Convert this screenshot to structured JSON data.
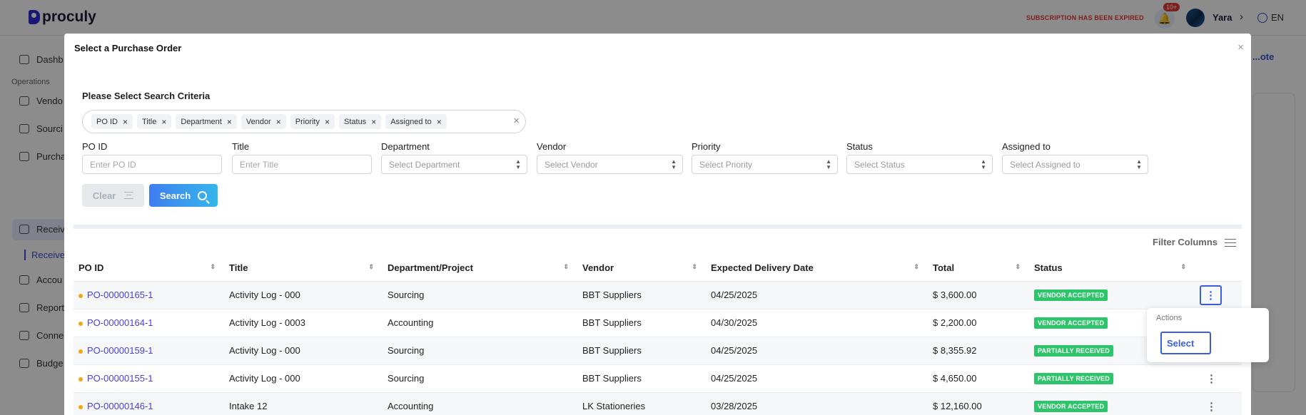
{
  "app": {
    "logo_text": "proculy",
    "subscription_notice": "SUBSCRIPTION HAS BEEN EXPIRED",
    "notification_count": "10+",
    "user_name": "Yara",
    "language": "EN",
    "bg_right_link": "...ote"
  },
  "sidebar": {
    "section_label": "Operations",
    "items": [
      {
        "label": "Dashb"
      },
      {
        "label": "Vendo"
      },
      {
        "label": "Sourci"
      },
      {
        "label": "Purcha"
      },
      {
        "label": "Receiv"
      },
      {
        "label": "Receive"
      },
      {
        "label": "Accou"
      },
      {
        "label": "Report"
      },
      {
        "label": "Conne"
      },
      {
        "label": "Budge"
      }
    ]
  },
  "modal": {
    "title": "Select a Purchase Order",
    "close_glyph": "×",
    "criteria_title": "Please Select Search Criteria",
    "criteria_tags": [
      "PO ID",
      "Title",
      "Department",
      "Vendor",
      "Priority",
      "Status",
      "Assigned to"
    ],
    "fields": [
      {
        "label": "PO ID",
        "placeholder": "Enter PO ID"
      },
      {
        "label": "Title",
        "placeholder": "Enter Title"
      },
      {
        "label": "Department",
        "placeholder": "Select Department"
      },
      {
        "label": "Vendor",
        "placeholder": "Select Vendor"
      },
      {
        "label": "Priority",
        "placeholder": "Select Priority"
      },
      {
        "label": "Status",
        "placeholder": "Select Status"
      },
      {
        "label": "Assigned to",
        "placeholder": "Select Assigned to"
      }
    ],
    "clear_label": "Clear",
    "search_label": "Search",
    "filter_columns_label": "Filter Columns"
  },
  "table": {
    "columns": [
      "PO ID",
      "Title",
      "Department/Project",
      "Vendor",
      "Expected Delivery Date",
      "Total",
      "Status"
    ],
    "rows": [
      {
        "po_id": "PO-00000165-1",
        "title": "Activity Log - 000",
        "department": "Sourcing",
        "vendor": "BBT Suppliers",
        "date": "04/25/2025",
        "total": "$ 3,600.00",
        "status": "VENDOR ACCEPTED"
      },
      {
        "po_id": "PO-00000164-1",
        "title": "Activity Log - 0003",
        "department": "Accounting",
        "vendor": "BBT Suppliers",
        "date": "04/30/2025",
        "total": "$ 2,200.00",
        "status": "VENDOR ACCEPTED"
      },
      {
        "po_id": "PO-00000159-1",
        "title": "Activity Log - 000",
        "department": "Sourcing",
        "vendor": "BBT Suppliers",
        "date": "04/25/2025",
        "total": "$ 8,355.92",
        "status": "PARTIALLY RECEIVED"
      },
      {
        "po_id": "PO-00000155-1",
        "title": "Activity Log - 000",
        "department": "Sourcing",
        "vendor": "BBT Suppliers",
        "date": "04/25/2025",
        "total": "$ 4,650.00",
        "status": "PARTIALLY RECEIVED"
      },
      {
        "po_id": "PO-00000146-1",
        "title": "Intake 12",
        "department": "Accounting",
        "vendor": "LK Stationeries",
        "date": "03/28/2025",
        "total": "$ 12,160.00",
        "status": "VENDOR ACCEPTED"
      }
    ]
  },
  "actions_menu": {
    "title": "Actions",
    "select_label": "Select"
  },
  "colors": {
    "accent": "#3b5ee0",
    "status_green": "#2ec46b",
    "link": "#4a3fd6",
    "expired_red": "#e53935"
  }
}
